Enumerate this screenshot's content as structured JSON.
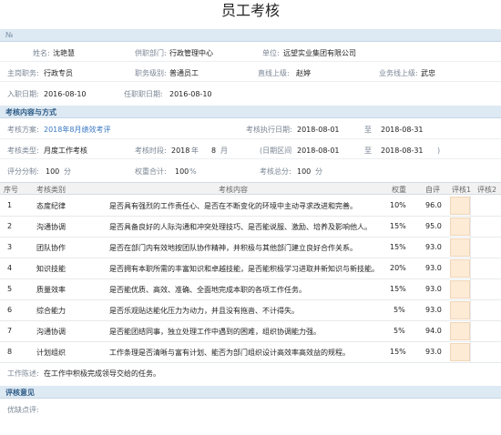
{
  "title": "员工考核",
  "no_bar": "№",
  "basic": {
    "name_label": "姓名:",
    "name": "沈艳慧",
    "dept_label": "供职部门:",
    "dept": "行政管理中心",
    "unit_label": "单位:",
    "unit": "远望实业集团有限公司",
    "post_label": "主岗职务:",
    "post": "行政专员",
    "level_label": "职务级别:",
    "level": "普通员工",
    "direct_label": "直线上级:",
    "direct": "赵婷",
    "biz_label": "业务线上级:",
    "biz": "武忠",
    "join_label": "入职日期:",
    "join": "2016-08-10",
    "appoint_label": "任职职日期:",
    "appoint": "2016-08-10"
  },
  "method_bar": "考核内容与方式",
  "method": {
    "plan_label": "考核方案:",
    "plan": "2018年8月绩效考评",
    "exec_label": "考核执行日期:",
    "exec_from": "2018-08-01",
    "to1": "至",
    "exec_to": "2018-08-31",
    "type_label": "考核类型:",
    "type": "月度工作考核",
    "period_label": "考核时段:",
    "year": "2018",
    "year_unit": "年",
    "month": "8",
    "month_unit": "月",
    "range_label": "(日期区间",
    "range_from": "2018-08-01",
    "to2": "至",
    "range_to": "2018-08-31",
    "range_close": ")",
    "score_label": "评分分制:",
    "score": "100",
    "score_unit": "分",
    "weight_label": "权重合计:",
    "weight": "100",
    "weight_unit": "%",
    "total_label": "考核总分:",
    "total": "100",
    "total_unit": "分"
  },
  "table": {
    "headers": [
      "序号",
      "考核类别",
      "考核内容",
      "权重",
      "自评",
      "评核1",
      "评核2"
    ],
    "rows": [
      {
        "no": "1",
        "cat": "态度纪律",
        "content": "是否具有强烈的工作责任心、是否在不断变化的环境中主动寻求改进和完善。",
        "weight": "10%",
        "self": "96.0"
      },
      {
        "no": "2",
        "cat": "沟通协调",
        "content": "是否具备良好的人际沟通和冲突处理技巧、是否能说服、激励、培养及影响他人。",
        "weight": "15%",
        "self": "95.0"
      },
      {
        "no": "3",
        "cat": "团队协作",
        "content": "是否在部门内有效地按团队协作精神，并积极与其他部门建立良好合作关系。",
        "weight": "15%",
        "self": "93.0"
      },
      {
        "no": "4",
        "cat": "知识技能",
        "content": "是否拥有本职所需的丰富知识和卓越技能，是否能积极学习进取并新知识与新技能。",
        "weight": "20%",
        "self": "93.0"
      },
      {
        "no": "5",
        "cat": "质量效率",
        "content": "是否能优质、高效、准确、全面地完成本职的各项工作任务。",
        "weight": "15%",
        "self": "93.0"
      },
      {
        "no": "6",
        "cat": "综合能力",
        "content": "是否乐观贴达能化压力为动力，并且没有拖沓、不计得失。",
        "weight": "5%",
        "self": "93.0"
      },
      {
        "no": "7",
        "cat": "沟通协调",
        "content": "是否能团结同事，独立处理工作中遇到的困难，组织协调能力强。",
        "weight": "5%",
        "self": "94.0"
      },
      {
        "no": "8",
        "cat": "计划组织",
        "content": "工作条理是否清晰与富有计划、能否为部门组织设计高效率高效益的规程。",
        "weight": "15%",
        "self": "93.0"
      }
    ]
  },
  "work_desc_label": "工作陈述:",
  "work_desc": "在工作中积极完成领导交给的任务。",
  "opinion_bar": "评核意见",
  "advantage_label": "优缺点评:"
}
